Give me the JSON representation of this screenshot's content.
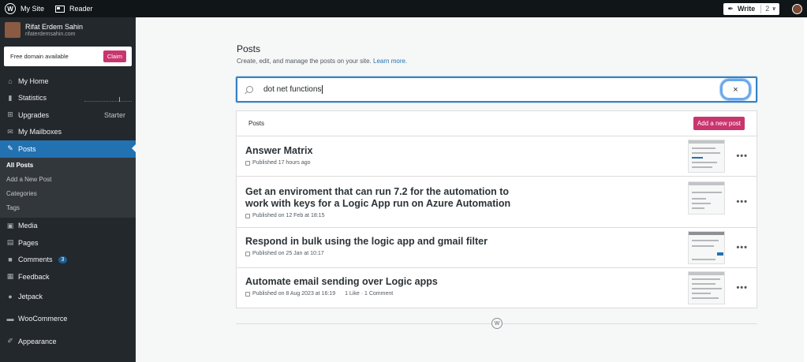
{
  "topbar": {
    "my_site": "My Site",
    "reader": "Reader",
    "write": "Write",
    "write_count": "2"
  },
  "sidebar": {
    "profile_name": "Rifat Erdem Sahin",
    "profile_url": "rifaterdemsahin.com",
    "domain_text": "Free domain available",
    "claim": "Claim",
    "items": [
      {
        "label": "My Home"
      },
      {
        "label": "Statistics"
      },
      {
        "label": "Upgrades",
        "extra": "Starter"
      },
      {
        "label": "My Mailboxes"
      },
      {
        "label": "Posts"
      }
    ],
    "submenu": [
      "All Posts",
      "Add a New Post",
      "Categories",
      "Tags"
    ],
    "items2": [
      {
        "label": "Media"
      },
      {
        "label": "Pages"
      },
      {
        "label": "Comments",
        "badge": "3"
      },
      {
        "label": "Feedback"
      },
      {
        "label": "Jetpack"
      },
      {
        "label": "WooCommerce"
      },
      {
        "label": "Appearance"
      }
    ]
  },
  "main": {
    "title": "Posts",
    "subtitle": "Create, edit, and manage the posts on your site.",
    "learn_more": "Learn more.",
    "search_value": "dot net functions",
    "close": "×",
    "list_header": "Posts",
    "add_new": "Add a new post",
    "posts": [
      {
        "title": "Answer Matrix",
        "meta": "Published 17 hours ago",
        "extra": ""
      },
      {
        "title": "Get an enviroment that can run 7.2 for the automation to work with keys for a Logic App run on Azure Automation",
        "meta": "Published on 12 Feb at 18:15",
        "extra": ""
      },
      {
        "title": "Respond in bulk using the logic app and gmail filter",
        "meta": "Published on 25 Jan at 10:17",
        "extra": ""
      },
      {
        "title": "Automate email sending over Logic apps",
        "meta": "Published on 8 Aug 2023 at 16:19",
        "extra": "1 Like · 1 Comment"
      }
    ],
    "more": "•••",
    "footer_logo": "W"
  },
  "icons": {
    "wordpress": "wordpress-logo-icon",
    "reader": "reader-icon",
    "write": "pen-icon",
    "home": "home-icon",
    "stats": "bar-chart-icon",
    "upgrades": "cart-icon",
    "mail": "mail-icon",
    "posts": "pin-icon",
    "media": "media-icon",
    "pages": "pages-icon",
    "comments": "comment-icon",
    "feedback": "feedback-icon",
    "jetpack": "jetpack-icon",
    "woocommerce": "woo-icon",
    "appearance": "brush-icon"
  },
  "colors": {
    "accent": "#2271b1",
    "pink": "#c9356e",
    "sidebar": "#23282d"
  }
}
